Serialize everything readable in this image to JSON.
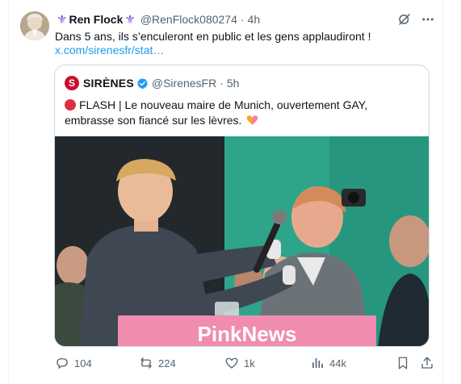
{
  "tweet": {
    "author_name": "Ren Flock",
    "author_handle": "@RenFlock080274",
    "time": "4h",
    "text": "Dans 5 ans, ils s’enculeront en public et les gens applaudiront !",
    "link": "x.com/sirenesfr/stat…",
    "icons": [
      "fleur-de-lis-icon",
      "grok-icon",
      "more-icon"
    ]
  },
  "quote": {
    "logo_letter": "S",
    "author_name": "SIRÈNES",
    "author_handle": "@SirenesFR",
    "time": "5h",
    "text": "FLASH | Le nouveau maire de Munich, ouvertement GAY, embrasse son fiancé sur les lèvres.",
    "media_caption": "PinkNews"
  },
  "actions": {
    "replies": "104",
    "reposts": "224",
    "likes": "1k",
    "views": "44k"
  },
  "colors": {
    "accent": "#1d9bf0",
    "text_secondary": "#536471",
    "pinknews": "#f08cb0",
    "red_logo": "#c8102e"
  }
}
